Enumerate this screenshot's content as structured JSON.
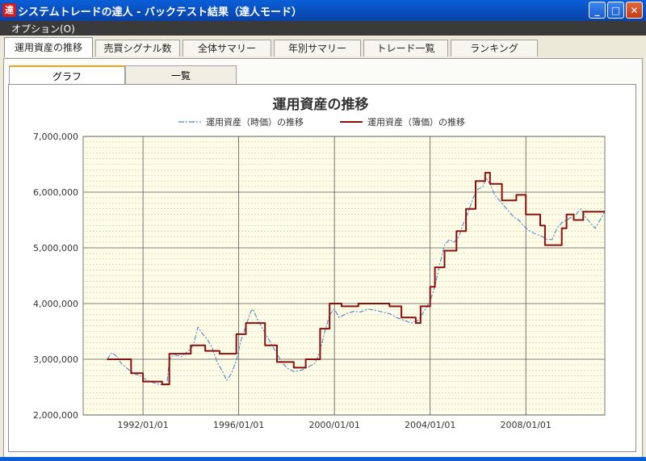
{
  "window": {
    "title": "システムトレードの達人 - バックテスト結果（達人モード）",
    "app_icon": "達",
    "minimize_label": "_",
    "maximize_label": "□",
    "close_label": "✕"
  },
  "menu": {
    "options_label": "オプション(O)"
  },
  "tabs": [
    {
      "label": "運用資産の推移",
      "active": true
    },
    {
      "label": "売買シグナル数",
      "active": false
    },
    {
      "label": "全体サマリー",
      "active": false
    },
    {
      "label": "年別サマリー",
      "active": false
    },
    {
      "label": "トレード一覧",
      "active": false
    },
    {
      "label": "ランキング",
      "active": false
    }
  ],
  "subtabs": [
    {
      "label": "グラフ",
      "active": true
    },
    {
      "label": "一覧",
      "active": false
    }
  ],
  "colors": {
    "plot_bg": "#fffde8",
    "market_line": "#4a86c8",
    "book_line": "#8b0e0e",
    "major_grid": "#555555",
    "minor_grid": "#c8c8a0"
  },
  "chart_data": {
    "type": "line",
    "title": "運用資産の推移",
    "legend_position": "top-center",
    "y_range": [
      2000000,
      7000000
    ],
    "y_ticks": [
      "2,000,000",
      "3,000,000",
      "4,000,000",
      "5,000,000",
      "6,000,000",
      "7,000,000"
    ],
    "x_range": [
      1989.5,
      2011.3
    ],
    "x_ticks": [
      {
        "label": "1992/01/01",
        "x": 1992
      },
      {
        "label": "1996/01/01",
        "x": 1996
      },
      {
        "label": "2000/01/01",
        "x": 2000
      },
      {
        "label": "2004/01/01",
        "x": 2004
      },
      {
        "label": "2008/01/01",
        "x": 2008
      }
    ],
    "series": [
      {
        "name": "運用資産（時価）の推移",
        "style": "dashdot",
        "points": [
          [
            1990.5,
            3000000
          ],
          [
            1990.7,
            3120000
          ],
          [
            1990.9,
            3050000
          ],
          [
            1991.1,
            2920000
          ],
          [
            1991.3,
            2850000
          ],
          [
            1991.5,
            2780000
          ],
          [
            1991.7,
            2730000
          ],
          [
            1991.9,
            2700000
          ],
          [
            1992.1,
            2640000
          ],
          [
            1992.3,
            2600000
          ],
          [
            1992.5,
            2570000
          ],
          [
            1992.8,
            2540000
          ],
          [
            1993.0,
            2550000
          ],
          [
            1993.1,
            3000000
          ],
          [
            1993.3,
            3080000
          ],
          [
            1993.6,
            3050000
          ],
          [
            1993.9,
            3150000
          ],
          [
            1994.1,
            3250000
          ],
          [
            1994.3,
            3580000
          ],
          [
            1994.5,
            3450000
          ],
          [
            1994.7,
            3350000
          ],
          [
            1994.9,
            3200000
          ],
          [
            1995.1,
            2950000
          ],
          [
            1995.3,
            2800000
          ],
          [
            1995.5,
            2620000
          ],
          [
            1995.7,
            2750000
          ],
          [
            1995.9,
            2980000
          ],
          [
            1996.1,
            3350000
          ],
          [
            1996.3,
            3600000
          ],
          [
            1996.5,
            3850000
          ],
          [
            1996.6,
            3900000
          ],
          [
            1996.8,
            3700000
          ],
          [
            1997.0,
            3550000
          ],
          [
            1997.2,
            3400000
          ],
          [
            1997.4,
            3250000
          ],
          [
            1997.6,
            3100000
          ],
          [
            1997.8,
            2950000
          ],
          [
            1998.0,
            2850000
          ],
          [
            1998.3,
            2780000
          ],
          [
            1998.6,
            2800000
          ],
          [
            1998.9,
            2860000
          ],
          [
            1999.2,
            2930000
          ],
          [
            1999.4,
            3150000
          ],
          [
            1999.6,
            3500000
          ],
          [
            1999.8,
            3800000
          ],
          [
            2000.0,
            3900000
          ],
          [
            2000.2,
            3750000
          ],
          [
            2000.5,
            3820000
          ],
          [
            2000.8,
            3860000
          ],
          [
            2001.1,
            3850000
          ],
          [
            2001.4,
            3900000
          ],
          [
            2001.7,
            3880000
          ],
          [
            2002.0,
            3850000
          ],
          [
            2002.3,
            3820000
          ],
          [
            2002.6,
            3750000
          ],
          [
            2002.9,
            3700000
          ],
          [
            2003.2,
            3650000
          ],
          [
            2003.5,
            3700000
          ],
          [
            2003.8,
            3900000
          ],
          [
            2004.0,
            4050000
          ],
          [
            2004.2,
            4300000
          ],
          [
            2004.4,
            4700000
          ],
          [
            2004.6,
            5050000
          ],
          [
            2004.8,
            5150000
          ],
          [
            2005.0,
            5100000
          ],
          [
            2005.2,
            5200000
          ],
          [
            2005.4,
            5450000
          ],
          [
            2005.6,
            5650000
          ],
          [
            2005.8,
            5900000
          ],
          [
            2006.0,
            6050000
          ],
          [
            2006.2,
            6100000
          ],
          [
            2006.35,
            6250000
          ],
          [
            2006.5,
            6150000
          ],
          [
            2006.7,
            5950000
          ],
          [
            2006.9,
            5850000
          ],
          [
            2007.1,
            5750000
          ],
          [
            2007.3,
            5650000
          ],
          [
            2007.5,
            5550000
          ],
          [
            2007.7,
            5500000
          ],
          [
            2007.9,
            5400000
          ],
          [
            2008.1,
            5320000
          ],
          [
            2008.4,
            5250000
          ],
          [
            2008.7,
            5200000
          ],
          [
            2008.9,
            5150000
          ],
          [
            2009.1,
            5150000
          ],
          [
            2009.3,
            5350000
          ],
          [
            2009.5,
            5450000
          ],
          [
            2009.7,
            5500000
          ],
          [
            2009.9,
            5550000
          ],
          [
            2010.1,
            5600000
          ],
          [
            2010.3,
            5700000
          ],
          [
            2010.5,
            5550000
          ],
          [
            2010.7,
            5450000
          ],
          [
            2010.9,
            5350000
          ],
          [
            2011.1,
            5500000
          ],
          [
            2011.3,
            5650000
          ]
        ]
      },
      {
        "name": "運用資産（簿価）の推移",
        "style": "step",
        "points": [
          [
            1990.5,
            3000000
          ],
          [
            1991.5,
            3000000
          ],
          [
            1991.5,
            2750000
          ],
          [
            1992.0,
            2750000
          ],
          [
            1992.0,
            2600000
          ],
          [
            1992.8,
            2600000
          ],
          [
            1992.8,
            2550000
          ],
          [
            1993.1,
            2550000
          ],
          [
            1993.1,
            3100000
          ],
          [
            1994.0,
            3100000
          ],
          [
            1994.0,
            3250000
          ],
          [
            1994.6,
            3250000
          ],
          [
            1994.6,
            3150000
          ],
          [
            1995.2,
            3150000
          ],
          [
            1995.2,
            3100000
          ],
          [
            1995.9,
            3100000
          ],
          [
            1995.9,
            3450000
          ],
          [
            1996.3,
            3450000
          ],
          [
            1996.3,
            3650000
          ],
          [
            1997.1,
            3650000
          ],
          [
            1997.1,
            3250000
          ],
          [
            1997.6,
            3250000
          ],
          [
            1997.6,
            2950000
          ],
          [
            1998.3,
            2950000
          ],
          [
            1998.3,
            2850000
          ],
          [
            1998.8,
            2850000
          ],
          [
            1998.8,
            3000000
          ],
          [
            1999.4,
            3000000
          ],
          [
            1999.4,
            3550000
          ],
          [
            1999.8,
            3550000
          ],
          [
            1999.8,
            4000000
          ],
          [
            2000.3,
            4000000
          ],
          [
            2000.3,
            3950000
          ],
          [
            2001.0,
            3950000
          ],
          [
            2001.0,
            4000000
          ],
          [
            2002.3,
            4000000
          ],
          [
            2002.3,
            3950000
          ],
          [
            2002.8,
            3950000
          ],
          [
            2002.8,
            3750000
          ],
          [
            2003.4,
            3750000
          ],
          [
            2003.4,
            3650000
          ],
          [
            2003.6,
            3650000
          ],
          [
            2003.6,
            3950000
          ],
          [
            2004.0,
            3950000
          ],
          [
            2004.0,
            4300000
          ],
          [
            2004.2,
            4300000
          ],
          [
            2004.2,
            4650000
          ],
          [
            2004.6,
            4650000
          ],
          [
            2004.6,
            4950000
          ],
          [
            2005.1,
            4950000
          ],
          [
            2005.1,
            5300000
          ],
          [
            2005.5,
            5300000
          ],
          [
            2005.5,
            5700000
          ],
          [
            2005.9,
            5700000
          ],
          [
            2005.9,
            6200000
          ],
          [
            2006.3,
            6200000
          ],
          [
            2006.3,
            6350000
          ],
          [
            2006.5,
            6350000
          ],
          [
            2006.5,
            6150000
          ],
          [
            2007.0,
            6150000
          ],
          [
            2007.0,
            5850000
          ],
          [
            2007.6,
            5850000
          ],
          [
            2007.6,
            5950000
          ],
          [
            2008.0,
            5950000
          ],
          [
            2008.0,
            5600000
          ],
          [
            2008.6,
            5600000
          ],
          [
            2008.6,
            5400000
          ],
          [
            2008.8,
            5400000
          ],
          [
            2008.8,
            5050000
          ],
          [
            2009.5,
            5050000
          ],
          [
            2009.5,
            5350000
          ],
          [
            2009.7,
            5350000
          ],
          [
            2009.7,
            5600000
          ],
          [
            2010.0,
            5600000
          ],
          [
            2010.0,
            5500000
          ],
          [
            2010.4,
            5500000
          ],
          [
            2010.4,
            5650000
          ],
          [
            2011.3,
            5650000
          ]
        ]
      }
    ]
  }
}
